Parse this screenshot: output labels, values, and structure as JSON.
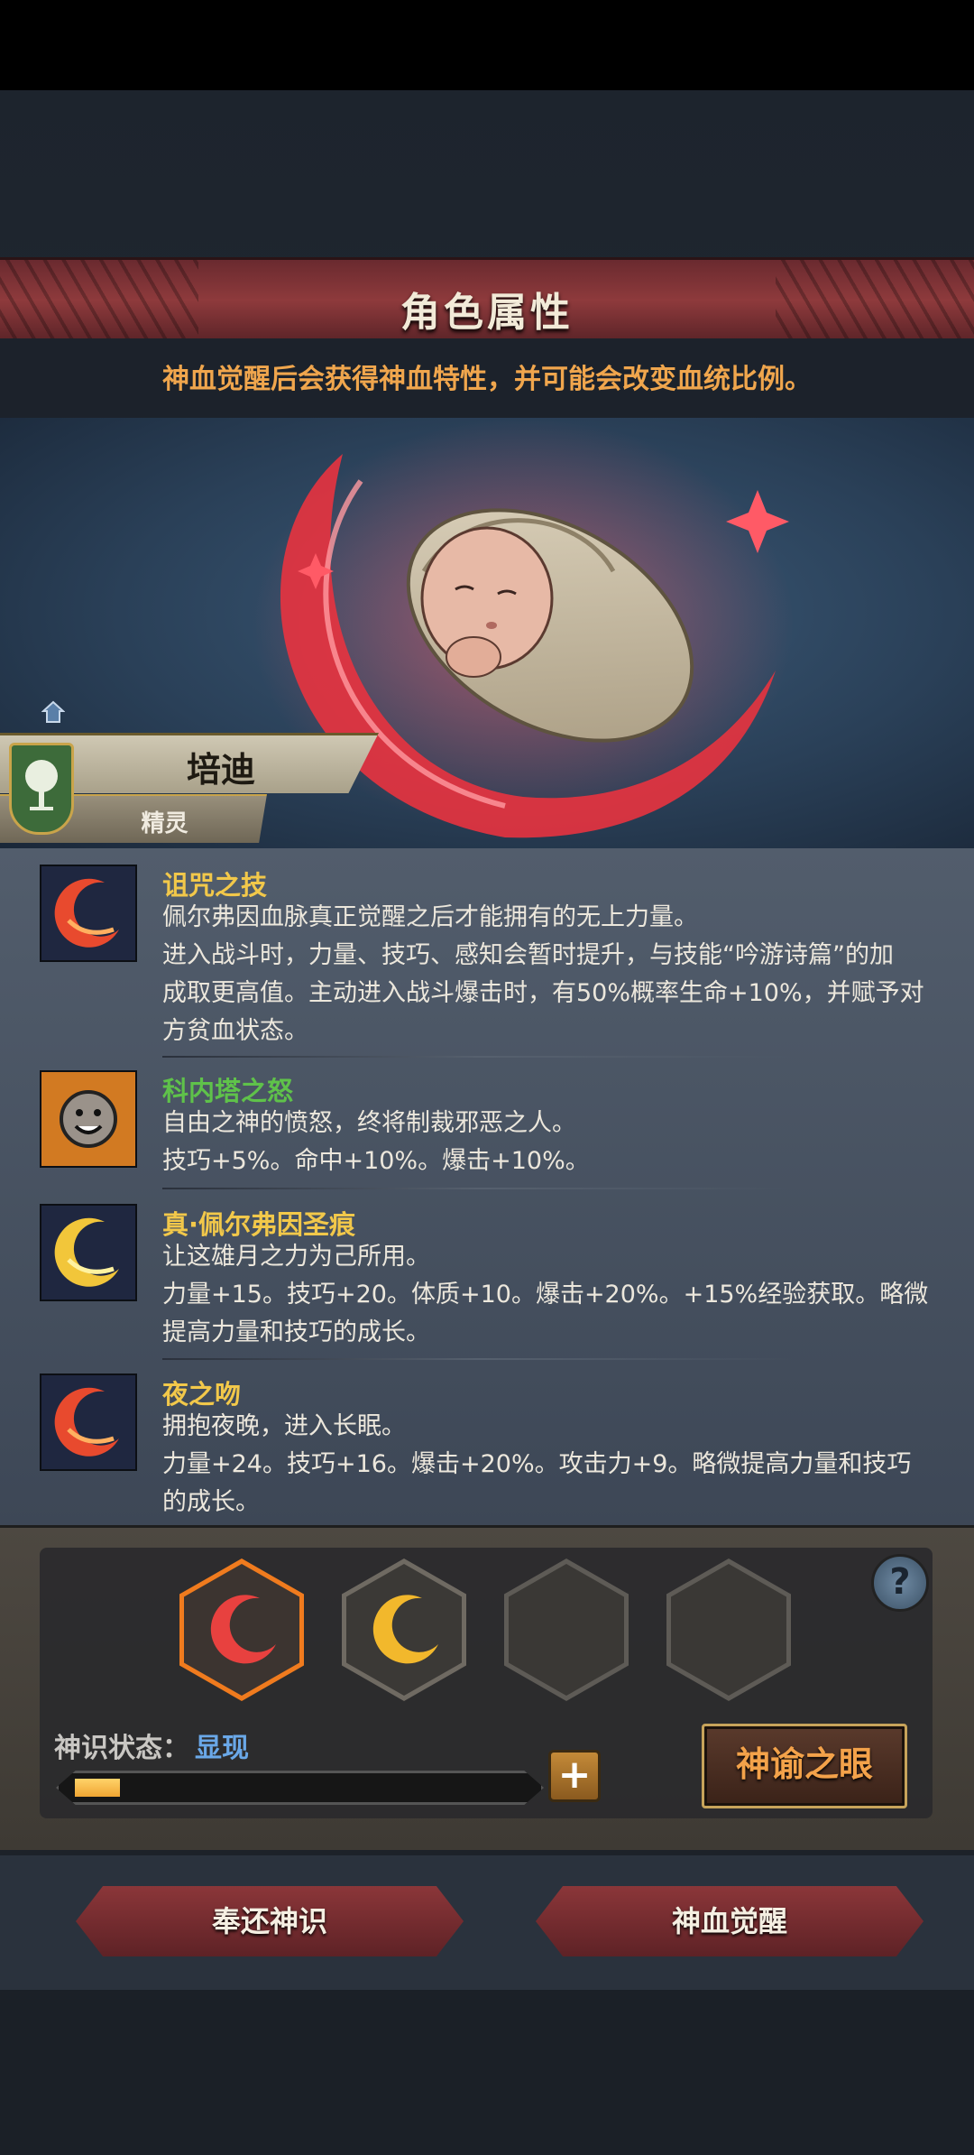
{
  "window": {
    "title": "角色属性",
    "notice": "神血觉醒后会获得神血特性，并可能会改变血统比例。"
  },
  "character": {
    "name": "培迪",
    "race": "精灵",
    "portrait": "swaddled-baby-with-red-crescent"
  },
  "traits": [
    {
      "name": "诅咒之技",
      "name_color": "#f2c84a",
      "icon": "red-crescent-icon",
      "lines": [
        "佩尔弗因血脉真正觉醒之后才能拥有的无上力量。",
        "进入战斗时，力量、技巧、感知会暂时提升，与技能“吟游诗篇”的加",
        "成取更高值。主动进入战斗爆击时，有50%概率生命+10%，并赋予对",
        "方贫血状态。"
      ]
    },
    {
      "name": "科内塔之怒",
      "name_color": "#5fc24a",
      "icon": "smiling-sun-icon",
      "lines": [
        "自由之神的愤怒，终将制裁邪恶之人。",
        "技巧+5%。命中+10%。爆击+10%。"
      ]
    },
    {
      "name": "真·佩尔弗因圣痕",
      "name_color": "#f2c84a",
      "icon": "gold-crescent-icon",
      "lines": [
        "让这雄月之力为己所用。",
        "力量+15。技巧+20。体质+10。爆击+20%。+15%经验获取。略微",
        "提高力量和技巧的成长。"
      ]
    },
    {
      "name": "夜之吻",
      "name_color": "#f2c84a",
      "icon": "red-crescent-icon",
      "lines": [
        "拥抱夜晚，进入长眠。",
        "力量+24。技巧+16。爆击+20%。攻击力+9。略微提高力量和技巧",
        "的成长。"
      ]
    }
  ],
  "awakening": {
    "slots": [
      "red-crescent-slot",
      "gold-crescent-slot",
      "empty-slot",
      "empty-slot"
    ],
    "status_label": "神识状态：",
    "status_value": "显现",
    "progress": 0.1,
    "plus_label": "+",
    "oracle_button": "神谕之眼",
    "help_label": "?"
  },
  "buttons": {
    "return": "奉还神识",
    "awaken": "神血觉醒"
  },
  "colors": {
    "title_red": "#8e3a3c",
    "notice_orange": "#f0a64d",
    "status_blue": "#6aa8e8",
    "progress_fill": "#f0a532"
  }
}
